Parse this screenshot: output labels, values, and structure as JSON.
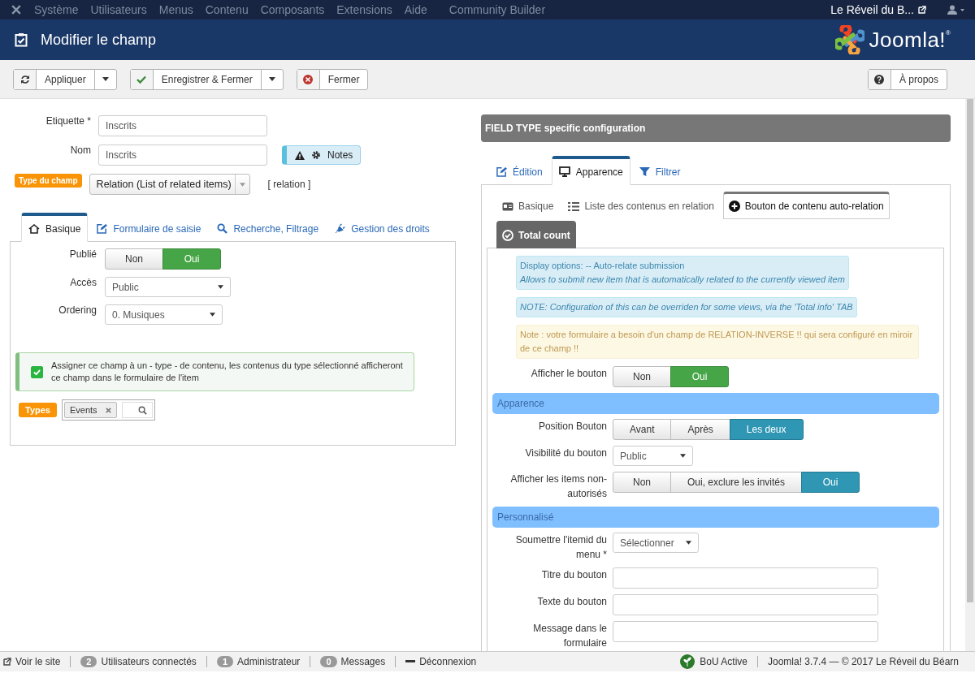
{
  "top_menu": {
    "items": [
      "Système",
      "Utilisateurs",
      "Menus",
      "Contenu",
      "Composants",
      "Extensions",
      "Aide",
      "Community Builder"
    ],
    "site_name": "Le Réveil du B..."
  },
  "header": {
    "title": "Modifier le champ",
    "brand": "Joomla!",
    "brand_mark": "®"
  },
  "toolbar": {
    "buttons": [
      {
        "label": "Appliquer",
        "has_dropdown": true
      },
      {
        "label": "Enregistrer & Fermer",
        "has_dropdown": true
      },
      {
        "label": "Fermer",
        "has_dropdown": false
      }
    ],
    "help_button": "À propos"
  },
  "main_form": {
    "fields": [
      {
        "label": "Etiquette *",
        "value": "Inscrits"
      },
      {
        "label": "Nom",
        "value": "Inscrits"
      }
    ],
    "notes_button": "Notes",
    "field_type": {
      "label": "Type du champ",
      "value": "Relation (List of related items)",
      "code": "[ relation ]"
    }
  },
  "left_tabs": [
    {
      "label": "Basique",
      "selected": true
    },
    {
      "label": "Formulaire de saisie",
      "selected": false
    },
    {
      "label": "Recherche, Filtrage",
      "selected": false
    },
    {
      "label": "Gestion des droits",
      "selected": false
    }
  ],
  "basic_panel": {
    "published": {
      "label": "Publié",
      "options": [
        {
          "label": "Non",
          "selected": false
        },
        {
          "label": "Oui",
          "selected": true
        }
      ]
    },
    "access": {
      "label": "Accès",
      "value": "Public"
    },
    "ordering": {
      "label": "Ordering",
      "value": "0. Musiques"
    },
    "assign_notice": {
      "checked": true,
      "text": "Assigner ce champ à un - type - de contenu, les contenus du type sélectionné afficheront ce champ dans le formulaire de l'item"
    },
    "types": {
      "label": "Types",
      "tags": [
        "Events"
      ]
    }
  },
  "config": {
    "title": "FIELD TYPE specific configuration",
    "tabs": [
      {
        "label": "Édition",
        "selected": false
      },
      {
        "label": "Apparence",
        "selected": true
      },
      {
        "label": "Filtrer",
        "selected": false
      }
    ],
    "subtabs": [
      {
        "label": "Basique",
        "selected": false,
        "dark": false
      },
      {
        "label": "Liste des contenus en relation",
        "selected": false,
        "dark": false
      },
      {
        "label": "Bouton de contenu auto-relation",
        "selected": true,
        "dark": false
      },
      {
        "label": "Total count",
        "selected": false,
        "dark": true
      }
    ],
    "notices": [
      {
        "kind": "info",
        "lines": [
          {
            "text": "Display options: -- Auto-relate submission",
            "italic": false
          },
          {
            "text": "Allows to submit new item that is automatically related to the currently viewed item",
            "italic": true
          }
        ]
      },
      {
        "kind": "info",
        "lines": [
          {
            "text": "NOTE: Configuration of this can be overriden for some views, via the 'Total info' TAB",
            "italic": true
          }
        ]
      },
      {
        "kind": "warning",
        "lines": [
          {
            "text": "Note : votre formulaire a besoin d'un champ de RELATION-INVERSE !! qui sera configuré en miroir de ce champ !!",
            "italic": false
          }
        ]
      }
    ],
    "rows": [
      {
        "kind": "yesno",
        "label": "Afficher le bouton",
        "options": [
          {
            "label": "Non",
            "selected": false
          },
          {
            "label": "Oui",
            "selected": true
          }
        ]
      },
      {
        "kind": "section",
        "label": "Apparence"
      },
      {
        "kind": "choice",
        "label": "Position Bouton",
        "options": [
          {
            "label": "Avant",
            "selected": false
          },
          {
            "label": "Après",
            "selected": false
          },
          {
            "label": "Les deux",
            "selected": true
          }
        ]
      },
      {
        "kind": "select",
        "label": "Visibilité du bouton",
        "value": "Public"
      },
      {
        "kind": "choice",
        "label": "Afficher les items non-autorisés",
        "options": [
          {
            "label": "Non",
            "selected": false
          },
          {
            "label": "Oui, exclure les invités",
            "selected": false
          },
          {
            "label": "Oui",
            "selected": true
          }
        ]
      },
      {
        "kind": "section",
        "label": "Personnalisé"
      },
      {
        "kind": "select",
        "label": "Soumettre l'itemid du menu *",
        "value": "Sélectionner"
      },
      {
        "kind": "text",
        "label": "Titre du bouton"
      },
      {
        "kind": "text",
        "label": "Texte du bouton"
      },
      {
        "kind": "text",
        "label": "Message dans le formulaire"
      }
    ]
  },
  "status_bar": {
    "items": [
      {
        "kind": "site",
        "label": "Voir le site"
      },
      {
        "kind": "count",
        "count": "2",
        "label": "Utilisateurs connectés"
      },
      {
        "kind": "count",
        "count": "1",
        "label": "Administrateur"
      },
      {
        "kind": "count",
        "count": "0",
        "label": "Messages"
      },
      {
        "kind": "logout",
        "label": "Déconnexion"
      }
    ],
    "badge": "BoU Active",
    "version": "Joomla! 3.7.4 — © 2017 Le Réveil du Béarn"
  }
}
